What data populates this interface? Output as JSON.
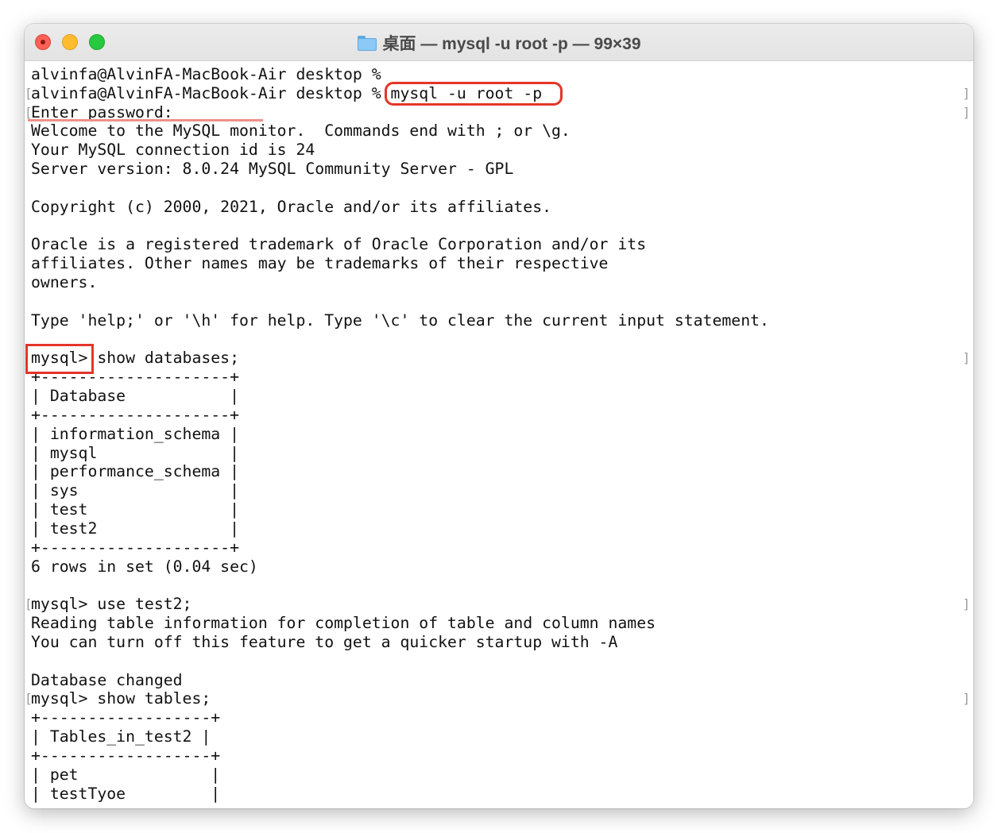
{
  "window": {
    "title_folder": "桌面",
    "title_sep1": " — ",
    "title_cmd": "mysql -u root -p",
    "title_sep2": " — ",
    "title_size": "99×39"
  },
  "terminal": {
    "lines": [
      "alvinfa@AlvinFA-MacBook-Air desktop %",
      "alvinfa@AlvinFA-MacBook-Air desktop % mysql -u root -p",
      "Enter password:",
      "Welcome to the MySQL monitor.  Commands end with ; or \\g.",
      "Your MySQL connection id is 24",
      "Server version: 8.0.24 MySQL Community Server - GPL",
      "",
      "Copyright (c) 2000, 2021, Oracle and/or its affiliates.",
      "",
      "Oracle is a registered trademark of Oracle Corporation and/or its",
      "affiliates. Other names may be trademarks of their respective",
      "owners.",
      "",
      "Type 'help;' or '\\h' for help. Type '\\c' to clear the current input statement.",
      "",
      "mysql> show databases;",
      "+--------------------+",
      "| Database           |",
      "+--------------------+",
      "| information_schema |",
      "| mysql              |",
      "| performance_schema |",
      "| sys                |",
      "| test               |",
      "| test2              |",
      "+--------------------+",
      "6 rows in set (0.04 sec)",
      "",
      "mysql> use test2;",
      "Reading table information for completion of table and column names",
      "You can turn off this feature to get a quicker startup with -A",
      "",
      "Database changed",
      "mysql> show tables;",
      "+------------------+",
      "| Tables_in_test2 |",
      "+------------------+",
      "| pet              |",
      "| testTyoe         |"
    ],
    "marker_left_glyph": "[",
    "marker_right_glyph": "]"
  },
  "annotations": {
    "color": "#e53528",
    "underline_color": "#f08f88"
  }
}
